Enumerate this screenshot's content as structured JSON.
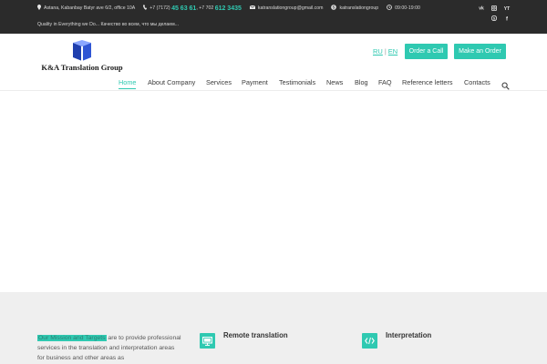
{
  "topbar": {
    "address": "Astana, Kabanbay Batyr ave 6/2, office 10A",
    "phone1_prefix": "+7 (7172)",
    "phone1_main": "45 63 61",
    "phone2_prefix": ", +7 702",
    "phone2_main": "612 3435",
    "email": "katranslationgroup@gmail.com",
    "skype": "katranslationgroup",
    "hours": "09:00-19:00",
    "tagline": "Quality in Everything we Do... Качество во всем, что мы делаем...",
    "social_row1": [
      "vk-icon",
      "instagram-icon",
      "youtube-icon"
    ],
    "social_row2": [
      "skype-icon",
      "facebook-icon"
    ]
  },
  "header": {
    "logo_text": "K&A Translation Group",
    "lang_ru": "RU",
    "lang_sep": "|",
    "lang_en": "EN",
    "order_call": "Order a Call",
    "make_order": "Make an Order"
  },
  "nav": {
    "home": "Home",
    "about": "About Company",
    "services": "Services",
    "payment": "Payment",
    "testimonials": "Testimonials",
    "news": "News",
    "blog": "Blog",
    "faq": "FAQ",
    "reference": "Reference letters",
    "contacts": "Contacts"
  },
  "services_section": {
    "mission_highlight": "Our Mission and Targets",
    "mission_text": " are to provide professional services in the translation and interpretation areas for business and other areas as",
    "remote_title": "Remote translation",
    "interp_title": "Interpretation"
  },
  "colors": {
    "accent": "#2fc9b1",
    "topbar_bg": "#2b2b2b",
    "services_bg": "#efefef",
    "logo_blue": "#1f3fae"
  }
}
